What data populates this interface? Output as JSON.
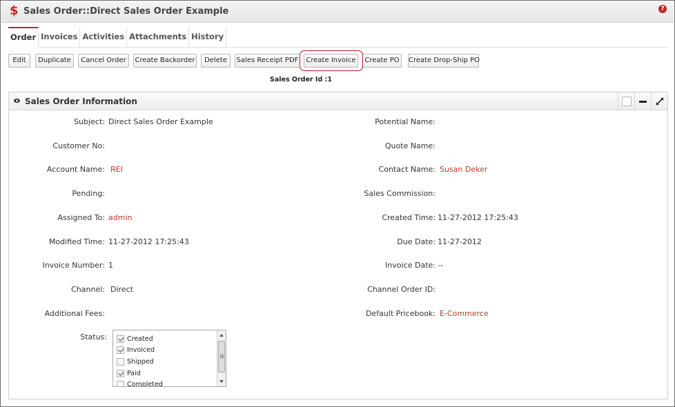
{
  "window": {
    "title": "Sales Order::Direct Sales Order Example",
    "title_icon": "$",
    "help_icon": "?"
  },
  "tabs": [
    {
      "label": "Order",
      "active": true
    },
    {
      "label": "Invoices"
    },
    {
      "label": "Activities"
    },
    {
      "label": "Attachments"
    },
    {
      "label": "History"
    }
  ],
  "toolbar": {
    "edit": "Edit",
    "duplicate": "Duplicate",
    "cancel_order": "Cancel Order",
    "create_backorder": "Create Backorder",
    "delete": "Delete",
    "sales_receipt_pdf": "Sales Receipt PDF",
    "create_invoice": "Create Invoice",
    "create_po": "Create PO",
    "create_dropship_po": "Create Drop-Ship PO"
  },
  "sales_order_id": "Sales Order Id :1",
  "panel": {
    "title": "Sales Order Information"
  },
  "fields": {
    "subject": {
      "label": "Subject:",
      "value": "Direct Sales Order Example"
    },
    "potential_name": {
      "label": "Potential Name:",
      "value": ""
    },
    "customer_no": {
      "label": "Customer No:",
      "value": ""
    },
    "quote_name": {
      "label": "Quote Name:",
      "value": ""
    },
    "account_name": {
      "label": "Account Name:",
      "value": "REI"
    },
    "contact_name": {
      "label": "Contact Name:",
      "value": "Susan Deker"
    },
    "pending": {
      "label": "Pending:",
      "value": ""
    },
    "sales_commission": {
      "label": "Sales Commission:",
      "value": ""
    },
    "assigned_to": {
      "label": "Assigned To:",
      "value": "admin"
    },
    "created_time": {
      "label": "Created Time:",
      "value": "11-27-2012 17:25:43"
    },
    "modified_time": {
      "label": "Modified Time:",
      "value": "11-27-2012 17:25:43"
    },
    "due_date": {
      "label": "Due Date:",
      "value": "11-27-2012"
    },
    "invoice_number": {
      "label": "Invoice Number:",
      "value": "1"
    },
    "invoice_date": {
      "label": "Invoice Date:",
      "value": "--"
    },
    "channel": {
      "label": "Channel:",
      "value": "Direct"
    },
    "channel_order_id": {
      "label": "Channel Order ID:",
      "value": ""
    },
    "additional_fees": {
      "label": "Additional Fees:",
      "value": ""
    },
    "default_pricebook": {
      "label": "Default Pricebook:",
      "value": "E-Commerce"
    }
  },
  "status": {
    "label": "Status:",
    "options": [
      {
        "label": "Created",
        "checked": true
      },
      {
        "label": "Invoiced",
        "checked": true
      },
      {
        "label": "Shipped",
        "checked": false
      },
      {
        "label": "Paid",
        "checked": true
      },
      {
        "label": "Completed",
        "checked": false
      }
    ]
  },
  "colors": {
    "accent": "#c3271d",
    "link": "#b9382c"
  }
}
